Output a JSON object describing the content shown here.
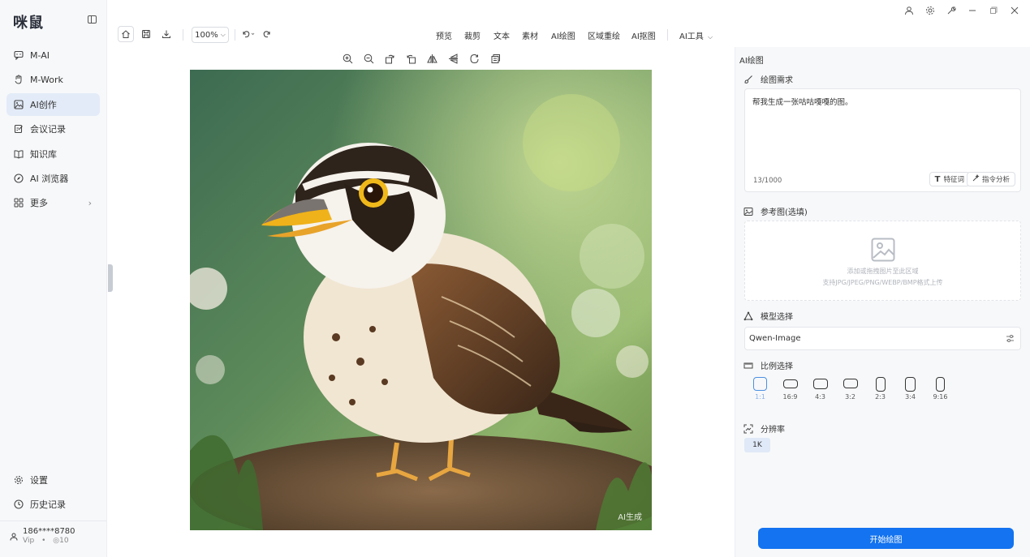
{
  "app": {
    "logo": "咪鼠"
  },
  "sidebar": {
    "items": [
      {
        "label": "M-AI",
        "icon": "chat-icon"
      },
      {
        "label": "M-Work",
        "icon": "hand-icon"
      },
      {
        "label": "AI创作",
        "icon": "image-icon",
        "active": true
      },
      {
        "label": "会议记录",
        "icon": "note-icon"
      },
      {
        "label": "知识库",
        "icon": "book-icon"
      },
      {
        "label": "AI 浏览器",
        "icon": "compass-icon"
      },
      {
        "label": "更多",
        "icon": "grid-icon"
      }
    ],
    "bottom": [
      {
        "label": "设置",
        "icon": "gear-icon"
      },
      {
        "label": "历史记录",
        "icon": "clock-icon"
      }
    ],
    "user": {
      "name": "186****8780",
      "tier": "Vip",
      "separator": "•",
      "credits": "◎10"
    }
  },
  "toolbar": {
    "zoom": "100%",
    "menus": [
      "预览",
      "裁剪",
      "文本",
      "素材",
      "AI绘图",
      "区域重绘",
      "AI抠图"
    ],
    "tools_menu": "AI工具"
  },
  "canvas": {
    "watermark": "AI生成"
  },
  "panel": {
    "title": "AI绘图",
    "prompt": {
      "label": "绘图需求",
      "value": "帮我生成一张咕咕嘎嘎的图。",
      "count": "13/1000",
      "feature_btn": "特征词",
      "analyze_btn": "指令分析"
    },
    "reference": {
      "label": "参考图(选填)",
      "hint1": "添加或拖拽图片至此区域",
      "hint2": "支持JPG/JPEG/PNG/WEBP/BMP格式上传"
    },
    "model": {
      "label": "模型选择",
      "value": "Qwen-Image"
    },
    "ratio": {
      "label": "比例选择",
      "options": [
        "1:1",
        "16:9",
        "4:3",
        "3:2",
        "2:3",
        "3:4",
        "9:16"
      ],
      "selected": "1:1"
    },
    "resolution": {
      "label": "分辨率",
      "value": "1K"
    },
    "start_btn": "开始绘图"
  },
  "colors": {
    "accent": "#1373f0",
    "active_nav": "#e3ebf8"
  }
}
